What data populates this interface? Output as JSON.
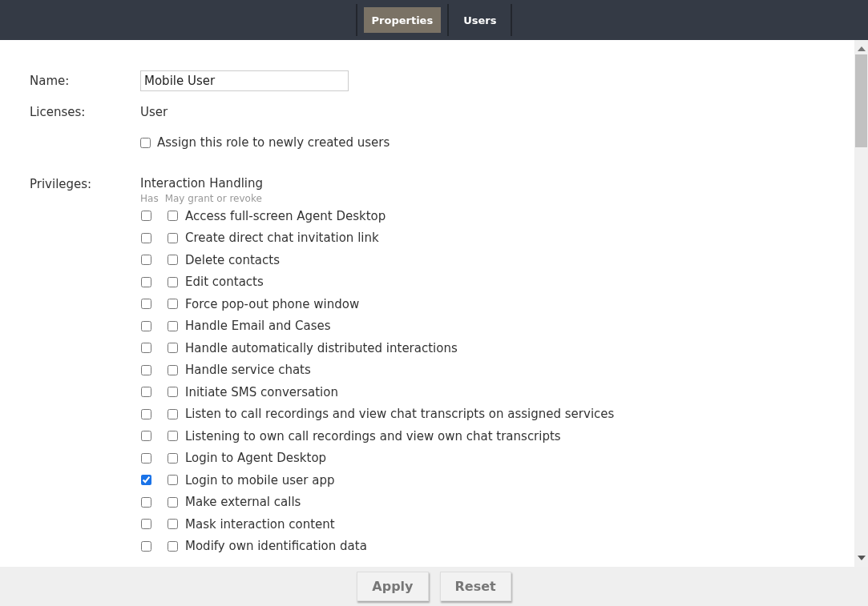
{
  "tabs": [
    {
      "label": "Properties",
      "selected": true
    },
    {
      "label": "Users",
      "selected": false
    }
  ],
  "form": {
    "name_label": "Name:",
    "name_value": "Mobile User",
    "licenses_label": "Licenses:",
    "licenses_value": "User",
    "assign": {
      "label": "Assign this role to newly created users",
      "checked": false
    },
    "privileges_label": "Privileges:"
  },
  "privileges": {
    "group": "Interaction Handling",
    "has_header": "Has",
    "grant_header": "May grant or revoke",
    "items": [
      {
        "label": "Access full-screen Agent Desktop",
        "has": false,
        "grant": false
      },
      {
        "label": "Create direct chat invitation link",
        "has": false,
        "grant": false
      },
      {
        "label": "Delete contacts",
        "has": false,
        "grant": false
      },
      {
        "label": "Edit contacts",
        "has": false,
        "grant": false
      },
      {
        "label": "Force pop-out phone window",
        "has": false,
        "grant": false
      },
      {
        "label": "Handle Email and Cases",
        "has": false,
        "grant": false
      },
      {
        "label": "Handle automatically distributed interactions",
        "has": false,
        "grant": false
      },
      {
        "label": "Handle service chats",
        "has": false,
        "grant": false
      },
      {
        "label": "Initiate SMS conversation",
        "has": false,
        "grant": false
      },
      {
        "label": "Listen to call recordings and view chat transcripts on assigned services",
        "has": false,
        "grant": false
      },
      {
        "label": "Listening to own call recordings and view own chat transcripts",
        "has": false,
        "grant": false
      },
      {
        "label": "Login to Agent Desktop",
        "has": false,
        "grant": false
      },
      {
        "label": "Login to mobile user app",
        "has": true,
        "grant": false
      },
      {
        "label": "Make external calls",
        "has": false,
        "grant": false
      },
      {
        "label": "Mask interaction content",
        "has": false,
        "grant": false
      },
      {
        "label": "Modify own identification data",
        "has": false,
        "grant": false
      }
    ]
  },
  "buttons": [
    "Apply",
    "Reset"
  ]
}
